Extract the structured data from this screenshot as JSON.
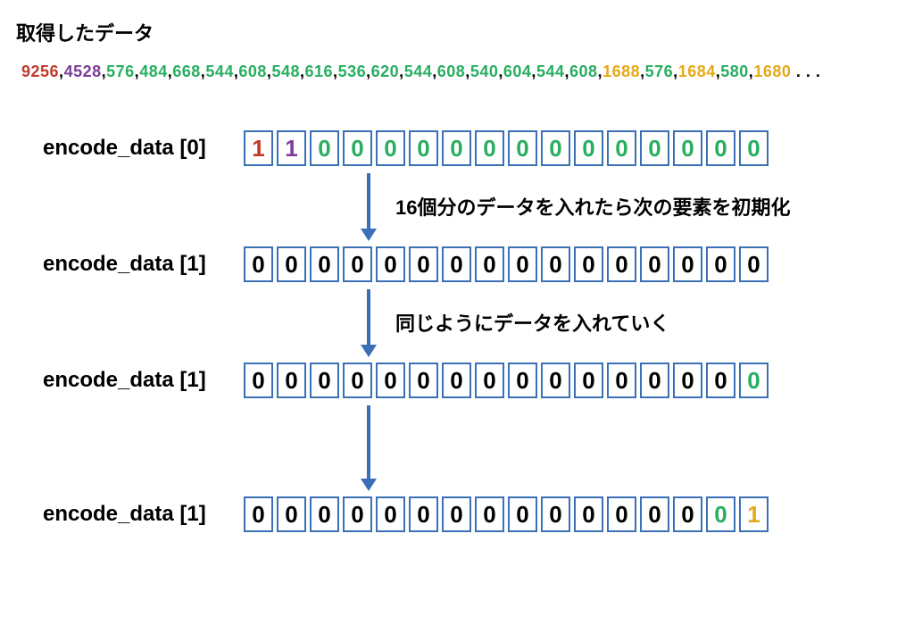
{
  "title": "取得したデータ",
  "raw_sequence": [
    {
      "v": "9256",
      "c": "red"
    },
    {
      "v": "4528",
      "c": "purple"
    },
    {
      "v": "576",
      "c": "green"
    },
    {
      "v": "484",
      "c": "green"
    },
    {
      "v": "668",
      "c": "green"
    },
    {
      "v": "544",
      "c": "green"
    },
    {
      "v": "608",
      "c": "green"
    },
    {
      "v": "548",
      "c": "green"
    },
    {
      "v": "616",
      "c": "green"
    },
    {
      "v": "536",
      "c": "green"
    },
    {
      "v": "620",
      "c": "green"
    },
    {
      "v": "544",
      "c": "green"
    },
    {
      "v": "608",
      "c": "green"
    },
    {
      "v": "540",
      "c": "green"
    },
    {
      "v": "604",
      "c": "green"
    },
    {
      "v": "544",
      "c": "green"
    },
    {
      "v": "608",
      "c": "green"
    },
    {
      "v": "1688",
      "c": "orange"
    },
    {
      "v": "576",
      "c": "green"
    },
    {
      "v": "1684",
      "c": "orange"
    },
    {
      "v": "580",
      "c": "green"
    },
    {
      "v": "1680",
      "c": "orange"
    }
  ],
  "raw_trailer": " . . .",
  "rows": [
    {
      "label": "encode_data [0]",
      "cells": [
        {
          "v": "1",
          "c": "red"
        },
        {
          "v": "1",
          "c": "purple"
        },
        {
          "v": "0",
          "c": "green"
        },
        {
          "v": "0",
          "c": "green"
        },
        {
          "v": "0",
          "c": "green"
        },
        {
          "v": "0",
          "c": "green"
        },
        {
          "v": "0",
          "c": "green"
        },
        {
          "v": "0",
          "c": "green"
        },
        {
          "v": "0",
          "c": "green"
        },
        {
          "v": "0",
          "c": "green"
        },
        {
          "v": "0",
          "c": "green"
        },
        {
          "v": "0",
          "c": "green"
        },
        {
          "v": "0",
          "c": "green"
        },
        {
          "v": "0",
          "c": "green"
        },
        {
          "v": "0",
          "c": "green"
        },
        {
          "v": "0",
          "c": "green"
        }
      ]
    },
    {
      "label": "encode_data [1]",
      "cells": [
        {
          "v": "0",
          "c": "black"
        },
        {
          "v": "0",
          "c": "black"
        },
        {
          "v": "0",
          "c": "black"
        },
        {
          "v": "0",
          "c": "black"
        },
        {
          "v": "0",
          "c": "black"
        },
        {
          "v": "0",
          "c": "black"
        },
        {
          "v": "0",
          "c": "black"
        },
        {
          "v": "0",
          "c": "black"
        },
        {
          "v": "0",
          "c": "black"
        },
        {
          "v": "0",
          "c": "black"
        },
        {
          "v": "0",
          "c": "black"
        },
        {
          "v": "0",
          "c": "black"
        },
        {
          "v": "0",
          "c": "black"
        },
        {
          "v": "0",
          "c": "black"
        },
        {
          "v": "0",
          "c": "black"
        },
        {
          "v": "0",
          "c": "black"
        }
      ]
    },
    {
      "label": "encode_data [1]",
      "cells": [
        {
          "v": "0",
          "c": "black"
        },
        {
          "v": "0",
          "c": "black"
        },
        {
          "v": "0",
          "c": "black"
        },
        {
          "v": "0",
          "c": "black"
        },
        {
          "v": "0",
          "c": "black"
        },
        {
          "v": "0",
          "c": "black"
        },
        {
          "v": "0",
          "c": "black"
        },
        {
          "v": "0",
          "c": "black"
        },
        {
          "v": "0",
          "c": "black"
        },
        {
          "v": "0",
          "c": "black"
        },
        {
          "v": "0",
          "c": "black"
        },
        {
          "v": "0",
          "c": "black"
        },
        {
          "v": "0",
          "c": "black"
        },
        {
          "v": "0",
          "c": "black"
        },
        {
          "v": "0",
          "c": "black"
        },
        {
          "v": "0",
          "c": "green"
        }
      ]
    },
    {
      "label": "encode_data [1]",
      "cells": [
        {
          "v": "0",
          "c": "black"
        },
        {
          "v": "0",
          "c": "black"
        },
        {
          "v": "0",
          "c": "black"
        },
        {
          "v": "0",
          "c": "black"
        },
        {
          "v": "0",
          "c": "black"
        },
        {
          "v": "0",
          "c": "black"
        },
        {
          "v": "0",
          "c": "black"
        },
        {
          "v": "0",
          "c": "black"
        },
        {
          "v": "0",
          "c": "black"
        },
        {
          "v": "0",
          "c": "black"
        },
        {
          "v": "0",
          "c": "black"
        },
        {
          "v": "0",
          "c": "black"
        },
        {
          "v": "0",
          "c": "black"
        },
        {
          "v": "0",
          "c": "black"
        },
        {
          "v": "0",
          "c": "green"
        },
        {
          "v": "1",
          "c": "orange"
        }
      ]
    }
  ],
  "arrows": [
    {
      "text": "16個分のデータを入れたら次の要素を初期化"
    },
    {
      "text": "同じようにデータを入れていく"
    },
    {
      "text": ""
    }
  ],
  "colors": {
    "red": "#c0392b",
    "purple": "#7d3c98",
    "green": "#27ae60",
    "orange": "#e6a817",
    "black": "#000000",
    "cell_border": "#3b6fb6",
    "arrow": "#3b6fb6"
  }
}
